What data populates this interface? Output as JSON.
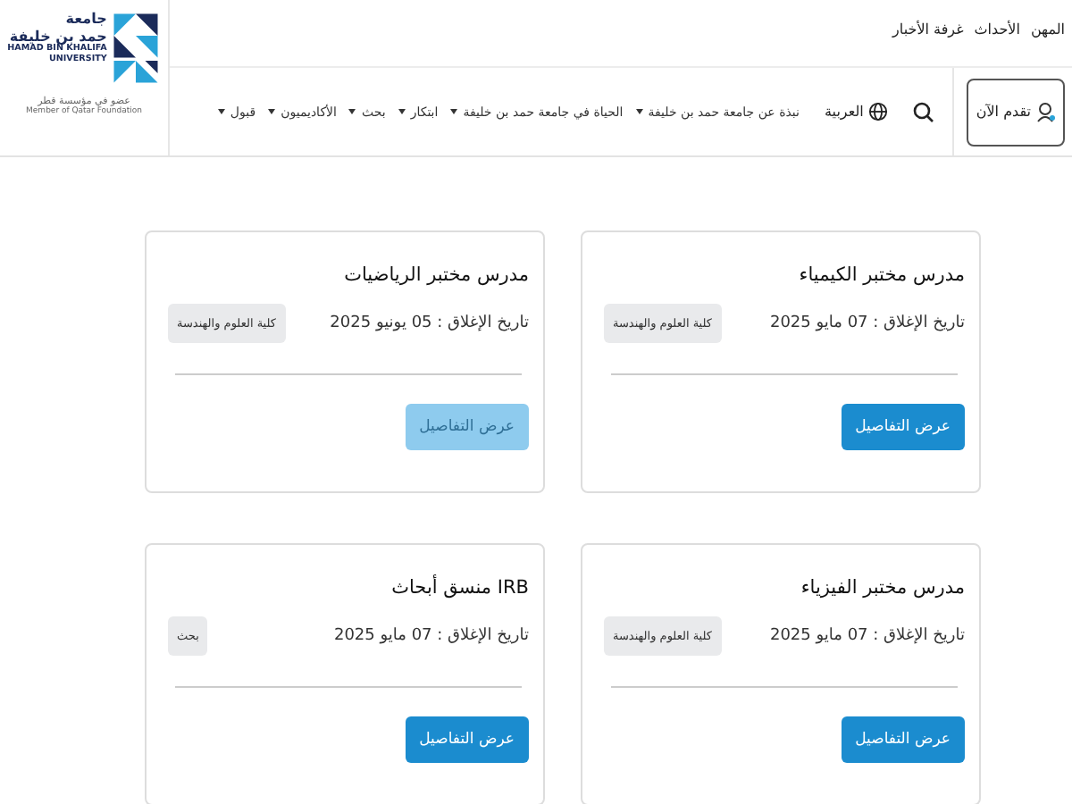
{
  "logo": {
    "arabic_name": "جامعة",
    "arabic_name_2": "حمد بن خليفة",
    "english_name": "HAMAD BIN KHALIFA",
    "english_name_2": "UNIVERSITY",
    "member_arabic": "عضو في مؤسسة قطر",
    "member_english": "Member of Qatar Foundation"
  },
  "top_links": [
    "المهن",
    "الأحداث",
    "غرفة الأخبار"
  ],
  "apply_button": {
    "label": "تقدم الآن"
  },
  "language": {
    "label": "العربية"
  },
  "nav": [
    {
      "label": "نبذة عن جامعة حمد بن خليفة",
      "has_menu": true
    },
    {
      "label": "الحياة في جامعة حمد بن خليفة",
      "has_menu": true
    },
    {
      "label": "ابتكار",
      "has_menu": true
    },
    {
      "label": "بحث",
      "has_menu": true
    },
    {
      "label": "الأكاديميون",
      "has_menu": true
    },
    {
      "label": "قبول",
      "has_menu": true
    }
  ],
  "jobs": [
    {
      "title": "مدرس مختبر الكيمياء",
      "closing": "تاريخ الإغلاق : 07 مايو 2025",
      "tag": "كلية العلوم والهندسة",
      "button": "عرض التفاصيل",
      "faded": false
    },
    {
      "title": "مدرس مختبر الرياضيات",
      "closing": "تاريخ الإغلاق : 05 يونيو 2025",
      "tag": "كلية العلوم والهندسة",
      "button": "عرض التفاصيل",
      "faded": true
    },
    {
      "title": "مدرس مختبر الفيزياء",
      "closing": "تاريخ الإغلاق : 07 مايو 2025",
      "tag": "كلية العلوم والهندسة",
      "button": "عرض التفاصيل",
      "faded": false
    },
    {
      "title": "IRB منسق أبحاث",
      "closing": "تاريخ الإغلاق : 07 مايو 2025",
      "tag": "بحث",
      "button": "عرض التفاصيل",
      "faded": false
    }
  ]
}
